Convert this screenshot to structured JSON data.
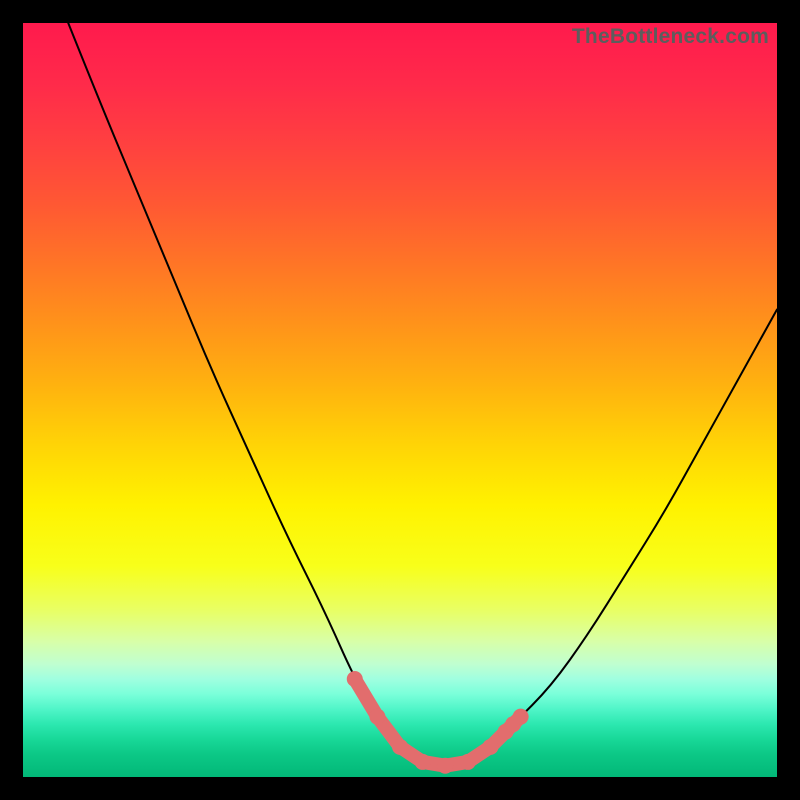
{
  "watermark": "TheBottleneck.com",
  "colors": {
    "frame_bg": "#000000",
    "curve_stroke": "#000000",
    "marker_fill": "#e26d6d",
    "watermark_text": "#5d5d5d"
  },
  "chart_data": {
    "type": "line",
    "title": "",
    "xlabel": "",
    "ylabel": "",
    "xlim": [
      0,
      100
    ],
    "ylim": [
      0,
      100
    ],
    "series": [
      {
        "name": "bottleneck-curve",
        "x": [
          6,
          10,
          15,
          20,
          25,
          30,
          35,
          40,
          44,
          47,
          50,
          53,
          56,
          59,
          62,
          65,
          70,
          75,
          80,
          85,
          90,
          95,
          100
        ],
        "y": [
          100,
          90,
          78,
          66,
          54,
          43,
          32,
          22,
          13,
          8,
          4,
          2,
          1.5,
          2,
          4,
          7,
          12,
          19,
          27,
          35,
          44,
          53,
          62
        ]
      }
    ],
    "markers": {
      "name": "highlight-dots",
      "x": [
        44,
        47,
        50,
        53,
        56,
        59,
        62,
        64,
        65,
        66
      ],
      "y": [
        13,
        8,
        4,
        2,
        1.5,
        2,
        4,
        6,
        7,
        8
      ]
    },
    "gradient_stops": [
      {
        "pos": 0,
        "color": "#ff1a4d"
      },
      {
        "pos": 50,
        "color": "#ffd000"
      },
      {
        "pos": 75,
        "color": "#fff200"
      },
      {
        "pos": 100,
        "color": "#02b878"
      }
    ]
  }
}
